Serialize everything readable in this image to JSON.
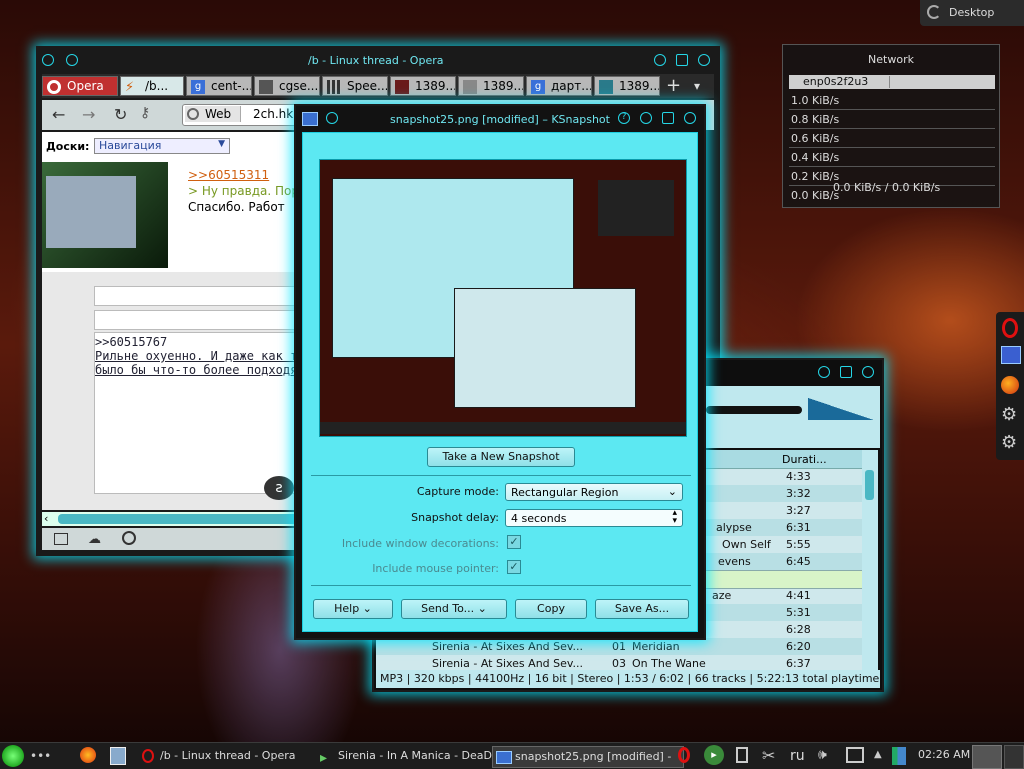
{
  "desktop_button": {
    "label": "Desktop"
  },
  "network": {
    "title": "Network",
    "interface": "enp0s2f2u3",
    "scale": [
      "1.0 KiB/s",
      "0.8 KiB/s",
      "0.6 KiB/s",
      "0.4 KiB/s",
      "0.2 KiB/s",
      "0.0 KiB/s"
    ],
    "rate": "0.0 KiB/s / 0.0 KiB/s"
  },
  "opera": {
    "title": "/b - Linux thread - Opera",
    "menu_label": "Opera",
    "tabs": [
      "/b...",
      "cent-...",
      "cgse...",
      "Spee...",
      "1389...",
      "1389...",
      "дарт...",
      "1389..."
    ],
    "address_mode": "Web",
    "address": "2ch.hk",
    "boards_label": "Доски:",
    "boards_select": "Навигация",
    "post1_link": ">>60515311",
    "post1_quote": "> Ну правда. Пор",
    "post1_text": "Спасибо. Работ",
    "post2_link": ">>60515767",
    "post2_line1": "Рильне охуенно. И даже как то",
    "post2_line2": "было бы что-то более подходя"
  },
  "music": {
    "col_duration": "Durati...",
    "rows": [
      {
        "artist": "",
        "num": "",
        "title": "",
        "dur": "4:33"
      },
      {
        "artist": "",
        "num": "",
        "title": "",
        "dur": "3:32"
      },
      {
        "artist": "",
        "num": "",
        "title": "",
        "dur": "3:27"
      },
      {
        "artist": "",
        "num": "",
        "title": "alypse",
        "dur": "6:31"
      },
      {
        "artist": "",
        "num": "",
        "title": "Own Self",
        "dur": "5:55"
      },
      {
        "artist": "",
        "num": "",
        "title": "evens",
        "dur": "6:45"
      },
      {
        "artist": "",
        "num": "",
        "title": "",
        "dur": ""
      },
      {
        "artist": "",
        "num": "",
        "title": "aze",
        "dur": "4:41"
      },
      {
        "artist": "",
        "num": "",
        "title": "",
        "dur": "5:31"
      },
      {
        "artist": "",
        "num": "",
        "title": "",
        "dur": "6:28"
      },
      {
        "artist": "Sirenia - At Sixes And Sev...",
        "num": "01",
        "title": "Meridian",
        "dur": "6:20"
      },
      {
        "artist": "Sirenia - At Sixes And Sev...",
        "num": "03",
        "title": "On The Wane",
        "dur": "6:37"
      }
    ],
    "status": "MP3 | 320 kbps | 44100Hz | 16 bit | Stereo | 1:53 / 6:02 | 66 tracks | 5:22:13 total playtime"
  },
  "ksnapshot": {
    "title": "snapshot25.png [modified] – KSnapshot",
    "new_snapshot": "Take a New Snapshot",
    "capture_mode_label": "Capture mode:",
    "capture_mode_value": "Rectangular Region",
    "delay_label": "Snapshot delay:",
    "delay_value": "4 seconds",
    "window_decorations": "Include window decorations:",
    "mouse_pointer": "Include mouse pointer:",
    "help": "Help",
    "send_to": "Send To...",
    "copy": "Copy",
    "save_as": "Save As..."
  },
  "taskbar": {
    "tasks": [
      "/b - Linux thread - Opera",
      "Sirenia - In A Manica - DeaD",
      "snapshot25.png [modified] -"
    ],
    "lang": "ru",
    "clock": "02:26 AM"
  }
}
